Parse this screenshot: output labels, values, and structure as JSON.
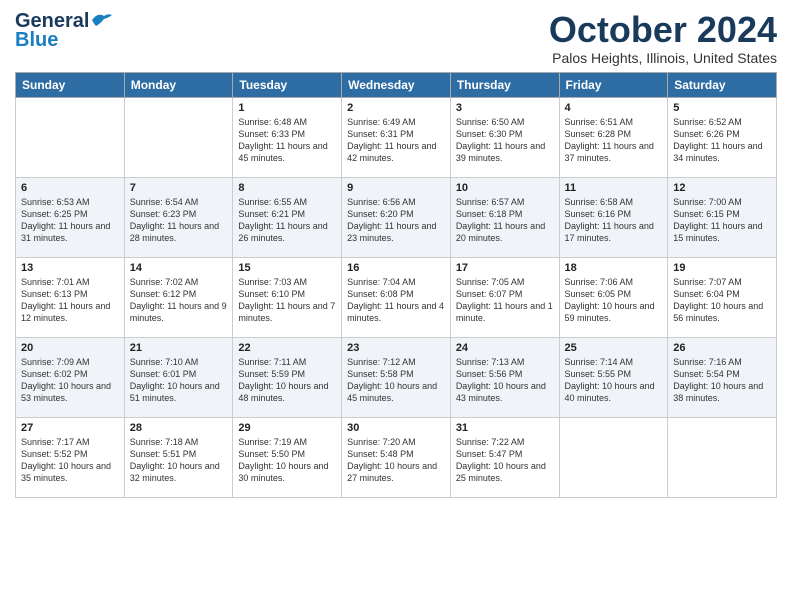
{
  "header": {
    "logo_line1": "General",
    "logo_line2": "Blue",
    "month": "October 2024",
    "location": "Palos Heights, Illinois, United States"
  },
  "weekdays": [
    "Sunday",
    "Monday",
    "Tuesday",
    "Wednesday",
    "Thursday",
    "Friday",
    "Saturday"
  ],
  "weeks": [
    [
      {
        "day": "",
        "content": ""
      },
      {
        "day": "",
        "content": ""
      },
      {
        "day": "1",
        "content": "Sunrise: 6:48 AM\nSunset: 6:33 PM\nDaylight: 11 hours and 45 minutes."
      },
      {
        "day": "2",
        "content": "Sunrise: 6:49 AM\nSunset: 6:31 PM\nDaylight: 11 hours and 42 minutes."
      },
      {
        "day": "3",
        "content": "Sunrise: 6:50 AM\nSunset: 6:30 PM\nDaylight: 11 hours and 39 minutes."
      },
      {
        "day": "4",
        "content": "Sunrise: 6:51 AM\nSunset: 6:28 PM\nDaylight: 11 hours and 37 minutes."
      },
      {
        "day": "5",
        "content": "Sunrise: 6:52 AM\nSunset: 6:26 PM\nDaylight: 11 hours and 34 minutes."
      }
    ],
    [
      {
        "day": "6",
        "content": "Sunrise: 6:53 AM\nSunset: 6:25 PM\nDaylight: 11 hours and 31 minutes."
      },
      {
        "day": "7",
        "content": "Sunrise: 6:54 AM\nSunset: 6:23 PM\nDaylight: 11 hours and 28 minutes."
      },
      {
        "day": "8",
        "content": "Sunrise: 6:55 AM\nSunset: 6:21 PM\nDaylight: 11 hours and 26 minutes."
      },
      {
        "day": "9",
        "content": "Sunrise: 6:56 AM\nSunset: 6:20 PM\nDaylight: 11 hours and 23 minutes."
      },
      {
        "day": "10",
        "content": "Sunrise: 6:57 AM\nSunset: 6:18 PM\nDaylight: 11 hours and 20 minutes."
      },
      {
        "day": "11",
        "content": "Sunrise: 6:58 AM\nSunset: 6:16 PM\nDaylight: 11 hours and 17 minutes."
      },
      {
        "day": "12",
        "content": "Sunrise: 7:00 AM\nSunset: 6:15 PM\nDaylight: 11 hours and 15 minutes."
      }
    ],
    [
      {
        "day": "13",
        "content": "Sunrise: 7:01 AM\nSunset: 6:13 PM\nDaylight: 11 hours and 12 minutes."
      },
      {
        "day": "14",
        "content": "Sunrise: 7:02 AM\nSunset: 6:12 PM\nDaylight: 11 hours and 9 minutes."
      },
      {
        "day": "15",
        "content": "Sunrise: 7:03 AM\nSunset: 6:10 PM\nDaylight: 11 hours and 7 minutes."
      },
      {
        "day": "16",
        "content": "Sunrise: 7:04 AM\nSunset: 6:08 PM\nDaylight: 11 hours and 4 minutes."
      },
      {
        "day": "17",
        "content": "Sunrise: 7:05 AM\nSunset: 6:07 PM\nDaylight: 11 hours and 1 minute."
      },
      {
        "day": "18",
        "content": "Sunrise: 7:06 AM\nSunset: 6:05 PM\nDaylight: 10 hours and 59 minutes."
      },
      {
        "day": "19",
        "content": "Sunrise: 7:07 AM\nSunset: 6:04 PM\nDaylight: 10 hours and 56 minutes."
      }
    ],
    [
      {
        "day": "20",
        "content": "Sunrise: 7:09 AM\nSunset: 6:02 PM\nDaylight: 10 hours and 53 minutes."
      },
      {
        "day": "21",
        "content": "Sunrise: 7:10 AM\nSunset: 6:01 PM\nDaylight: 10 hours and 51 minutes."
      },
      {
        "day": "22",
        "content": "Sunrise: 7:11 AM\nSunset: 5:59 PM\nDaylight: 10 hours and 48 minutes."
      },
      {
        "day": "23",
        "content": "Sunrise: 7:12 AM\nSunset: 5:58 PM\nDaylight: 10 hours and 45 minutes."
      },
      {
        "day": "24",
        "content": "Sunrise: 7:13 AM\nSunset: 5:56 PM\nDaylight: 10 hours and 43 minutes."
      },
      {
        "day": "25",
        "content": "Sunrise: 7:14 AM\nSunset: 5:55 PM\nDaylight: 10 hours and 40 minutes."
      },
      {
        "day": "26",
        "content": "Sunrise: 7:16 AM\nSunset: 5:54 PM\nDaylight: 10 hours and 38 minutes."
      }
    ],
    [
      {
        "day": "27",
        "content": "Sunrise: 7:17 AM\nSunset: 5:52 PM\nDaylight: 10 hours and 35 minutes."
      },
      {
        "day": "28",
        "content": "Sunrise: 7:18 AM\nSunset: 5:51 PM\nDaylight: 10 hours and 32 minutes."
      },
      {
        "day": "29",
        "content": "Sunrise: 7:19 AM\nSunset: 5:50 PM\nDaylight: 10 hours and 30 minutes."
      },
      {
        "day": "30",
        "content": "Sunrise: 7:20 AM\nSunset: 5:48 PM\nDaylight: 10 hours and 27 minutes."
      },
      {
        "day": "31",
        "content": "Sunrise: 7:22 AM\nSunset: 5:47 PM\nDaylight: 10 hours and 25 minutes."
      },
      {
        "day": "",
        "content": ""
      },
      {
        "day": "",
        "content": ""
      }
    ]
  ]
}
